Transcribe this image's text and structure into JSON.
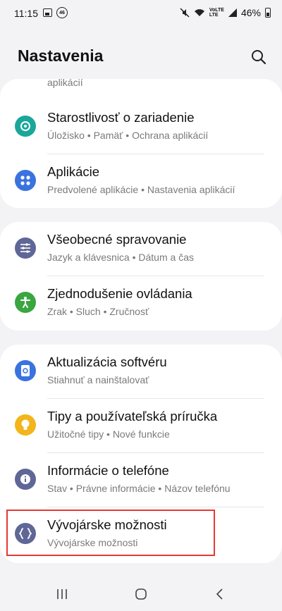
{
  "status_bar": {
    "time": "11:15",
    "badge": "46",
    "network_label_top": "VoLTE",
    "network_label_bottom": "LTE",
    "battery": "46%"
  },
  "header": {
    "title": "Nastavenia",
    "search_icon": "search-icon"
  },
  "partial_item": {
    "sub": "aplikácií"
  },
  "groups": [
    {
      "items": [
        {
          "label": "Starostlivosť o zariadenie",
          "sub": "Úložisko  •  Pamäť  •  Ochrana aplikácií",
          "icon": "device-care-icon",
          "color": "#1aa79a"
        },
        {
          "label": "Aplikácie",
          "sub": "Predvolené aplikácie  •  Nastavenia aplikácií",
          "icon": "apps-icon",
          "color": "#3a73e0"
        }
      ]
    },
    {
      "items": [
        {
          "label": "Všeobecné spravovanie",
          "sub": "Jazyk a klávesnica  •  Dátum a čas",
          "icon": "sliders-icon",
          "color": "#5f6797"
        },
        {
          "label": "Zjednodušenie ovládania",
          "sub": "Zrak  •  Sluch  •  Zručnosť",
          "icon": "accessibility-icon",
          "color": "#3aa640"
        }
      ]
    },
    {
      "items": [
        {
          "label": "Aktualizácia softvéru",
          "sub": "Stiahnuť a nainštalovať",
          "icon": "software-update-icon",
          "color": "#3a73e0"
        },
        {
          "label": "Tipy a používateľská príručka",
          "sub": "Užitočné tipy  •  Nové funkcie",
          "icon": "lightbulb-icon",
          "color": "#f2b51b"
        },
        {
          "label": "Informácie o telefóne",
          "sub": "Stav  •  Právne informácie  •  Názov telefónu",
          "icon": "info-icon",
          "color": "#5f6797"
        },
        {
          "label": "Vývojárske možnosti",
          "sub": "Vývojárske možnosti",
          "icon": "developer-braces-icon",
          "color": "#5f6797"
        }
      ]
    }
  ],
  "nav": {
    "recents": "recents-icon",
    "home": "home-icon",
    "back": "back-icon"
  }
}
